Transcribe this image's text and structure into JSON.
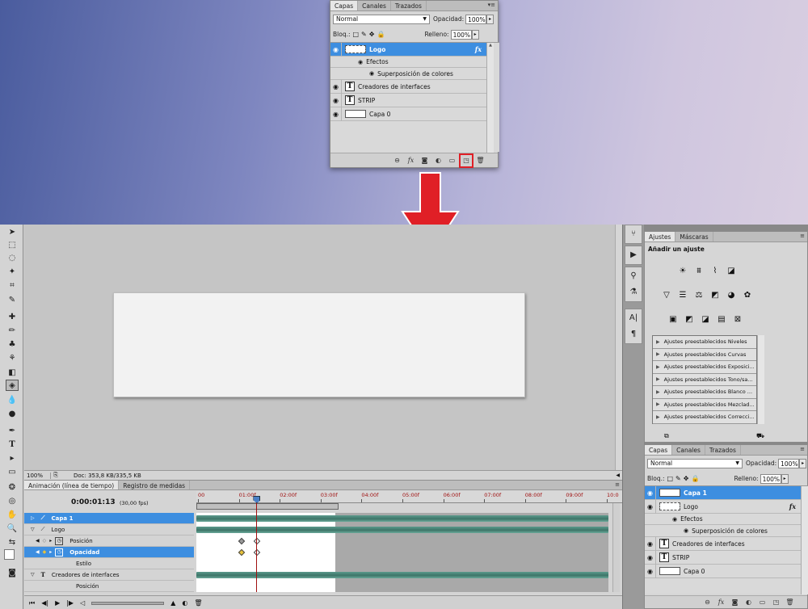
{
  "top_panel": {
    "tabs": [
      "Capas",
      "Canales",
      "Trazados"
    ],
    "blend_mode": "Normal",
    "opacity_label": "Opacidad:",
    "opacity_value": "100%",
    "lock_label": "Bloq.:",
    "fill_label": "Relleno:",
    "fill_value": "100%",
    "layers": [
      "Logo",
      "Efectos",
      "Superposición de colores",
      "Creadores de interfaces",
      "STRIP",
      "Capa 0"
    ],
    "fx": "fx"
  },
  "status": {
    "zoom": "100%",
    "doc": "Doc: 353,8 KB/335,5 KB"
  },
  "timeline": {
    "tabs": [
      "Animación (línea de tiempo)",
      "Registro de medidas"
    ],
    "time": "0:00:01:13",
    "fps": "(30,00 fps)",
    "ticks": [
      "00",
      "01:00f",
      "02:00f",
      "03:00f",
      "04:00f",
      "05:00f",
      "06:00f",
      "07:00f",
      "08:00f",
      "09:00f",
      "10:0"
    ],
    "rows": [
      "Capa 1",
      "Logo",
      "Posición",
      "Opacidad",
      "Estilo",
      "Creadores de interfaces",
      "Posición"
    ]
  },
  "adjustments": {
    "tabs": [
      "Ajustes",
      "Máscaras"
    ],
    "title": "Añadir un ajuste",
    "presets": [
      "Ajustes preestablecidos Niveles",
      "Ajustes preestablecidos Curvas",
      "Ajustes preestablecidos Exposici...",
      "Ajustes preestablecidos Tono/sa...",
      "Ajustes preestablecidos Blanco ...",
      "Ajustes preestablecidos Mezclad...",
      "Ajustes preestablecidos Correcci..."
    ]
  },
  "bottom_panel": {
    "tabs": [
      "Capas",
      "Canales",
      "Trazados"
    ],
    "blend_mode": "Normal",
    "opacity_label": "Opacidad:",
    "opacity_value": "100%",
    "lock_label": "Bloq.:",
    "fill_label": "Relleno:",
    "fill_value": "100%",
    "layers": [
      "Capa 1",
      "Logo",
      "Efectos",
      "Superposición de colores",
      "Creadores de interfaces",
      "STRIP",
      "Capa 0"
    ],
    "fx": "fx"
  },
  "colors": {
    "selection": "#3d8ee0",
    "arrow": "#e01f26",
    "track": "#4a8577",
    "playhead": "#a01010"
  },
  "playhead_fraction": 0.146
}
